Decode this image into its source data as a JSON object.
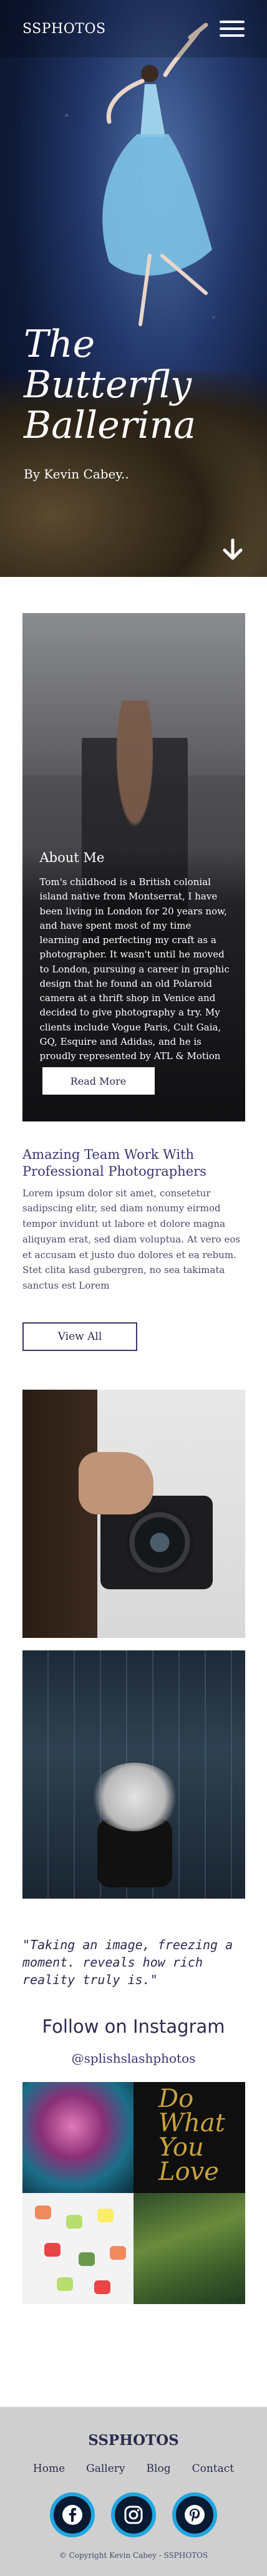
{
  "nav": {
    "brand": "SSPHOTOS",
    "menu_icon": "hamburger-icon"
  },
  "hero": {
    "title": "The Butterfly Ballerina",
    "author": "By Kevin Cabey..",
    "scroll_icon": "arrow-down-icon"
  },
  "about": {
    "heading": "About Me",
    "text": "Tom's childhood is a British colonial island native from Montserrat, I have been living in London for 20 years now, and have spent most of my time learning and perfecting my craft as a photographer. It wasn't until he moved to London, pursuing a career in graphic design that he found an old Polaroid camera at a thrift shop in Venice and decided to give photography a try. My clients include Vogue Paris, Cult Gaia, GQ, Esquire and Adidas, and he is proudly represented by ATL & Motion",
    "button": "Read More"
  },
  "team": {
    "heading": "Amazing Team Work With Professional Photographers",
    "text": "Lorem ipsum dolor sit amet, consetetur sadipscing elitr, sed diam nonumy eirmod tempor invidunt ut labore et dolore magna aliquyam erat, sed diam voluptua. At vero eos et accusam et justo duo dolores et ea rebum. Stet clita kasd gubergren, no sea takimata sanctus est Lorem",
    "button": "View All"
  },
  "quote": "\"Taking an image, freezing a moment. reveals how rich reality truly is.\"",
  "instagram": {
    "heading": "Follow on Instagram",
    "handle": "@splishslashphotos",
    "tile2_text": "Do What You Love"
  },
  "footer": {
    "brand": "SSPHOTOS",
    "links": [
      "Home",
      "Gallery",
      "Blog",
      "Contact"
    ],
    "socials": [
      "facebook-icon",
      "instagram-icon",
      "pinterest-icon"
    ],
    "copyright": "© Copyright Kevin Cabey - SSPHOTOS"
  },
  "colors": {
    "accent": "#3a3574",
    "social_ring": "#1fa6e0",
    "footer_bg": "#cfcfcf"
  }
}
